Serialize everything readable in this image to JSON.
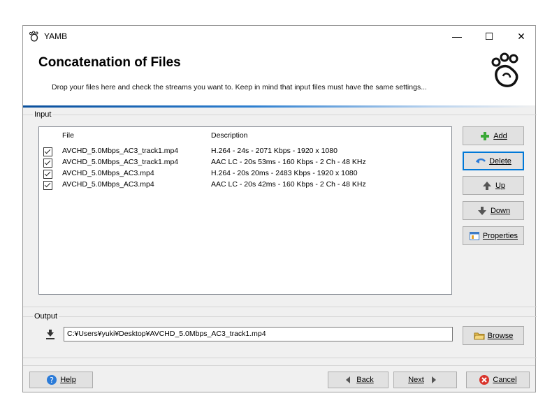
{
  "window": {
    "title": "YAMB",
    "minimize_glyph": "—",
    "maximize_glyph": "☐",
    "close_glyph": "✕",
    "app_icon": "yamb-footprint-icon"
  },
  "header": {
    "title": "Concatenation of Files",
    "subtitle": "Drop your files here and check the streams you want to. Keep in mind that input files must have the same settings..."
  },
  "input": {
    "legend": "Input",
    "columns": {
      "file": "File",
      "description": "Description"
    },
    "rows": [
      {
        "checked": true,
        "file": "AVCHD_5.0Mbps_AC3_track1.mp4",
        "description": "H.264 - 24s - 2071 Kbps - 1920 x 1080"
      },
      {
        "checked": true,
        "file": "AVCHD_5.0Mbps_AC3_track1.mp4",
        "description": "AAC LC - 20s 53ms - 160 Kbps - 2 Ch - 48 KHz"
      },
      {
        "checked": true,
        "file": "AVCHD_5.0Mbps_AC3.mp4",
        "description": "H.264 - 20s 20ms - 2483 Kbps - 1920 x 1080"
      },
      {
        "checked": true,
        "file": "AVCHD_5.0Mbps_AC3.mp4",
        "description": "AAC LC - 20s 42ms - 160 Kbps - 2 Ch - 48 KHz"
      }
    ],
    "buttons": {
      "add": "Add",
      "delete": "Delete",
      "up": "Up",
      "down": "Down",
      "properties": "Properties"
    }
  },
  "output": {
    "legend": "Output",
    "path": "C:¥Users¥yuki¥Desktop¥AVCHD_5.0Mbps_AC3_track1.mp4",
    "browse": "Browse"
  },
  "footer": {
    "help": "Help",
    "back": "Back",
    "next": "Next",
    "cancel": "Cancel"
  },
  "colors": {
    "accent": "#0078d7",
    "header_bar": "#0a4f9c",
    "add_icon": "#3aa836",
    "cancel_icon": "#d9342b",
    "help_icon": "#2b7bd8"
  }
}
